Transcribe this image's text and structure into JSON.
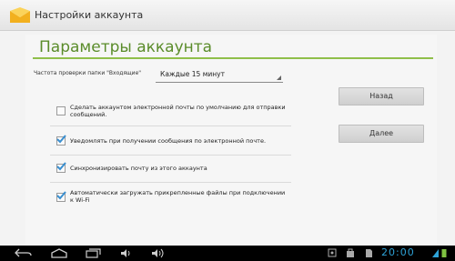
{
  "actionbar": {
    "title": "Настройки аккаунта"
  },
  "page": {
    "title": "Параметры аккаунта"
  },
  "frequency": {
    "label": "Частота проверки папки \"Входящие\"",
    "value": "Каждые 15 минут"
  },
  "options": [
    {
      "label": "Сделать аккаунтом электронной почты по умолчанию для отправки сообщений.",
      "checked": false
    },
    {
      "label": "Уведомлять при получении сообщения по электронной почте.",
      "checked": true
    },
    {
      "label": "Синхронизировать почту из этого аккаунта",
      "checked": true
    },
    {
      "label": "Автоматически загружать прикрепленные файлы при подключении к Wi-Fi",
      "checked": true
    }
  ],
  "buttons": {
    "back": "Назад",
    "next": "Далее"
  },
  "statusbar": {
    "time": "20:00"
  },
  "colors": {
    "accent": "#5a8c2a",
    "check": "#3a8fd0",
    "clock": "#2ea3d8"
  }
}
